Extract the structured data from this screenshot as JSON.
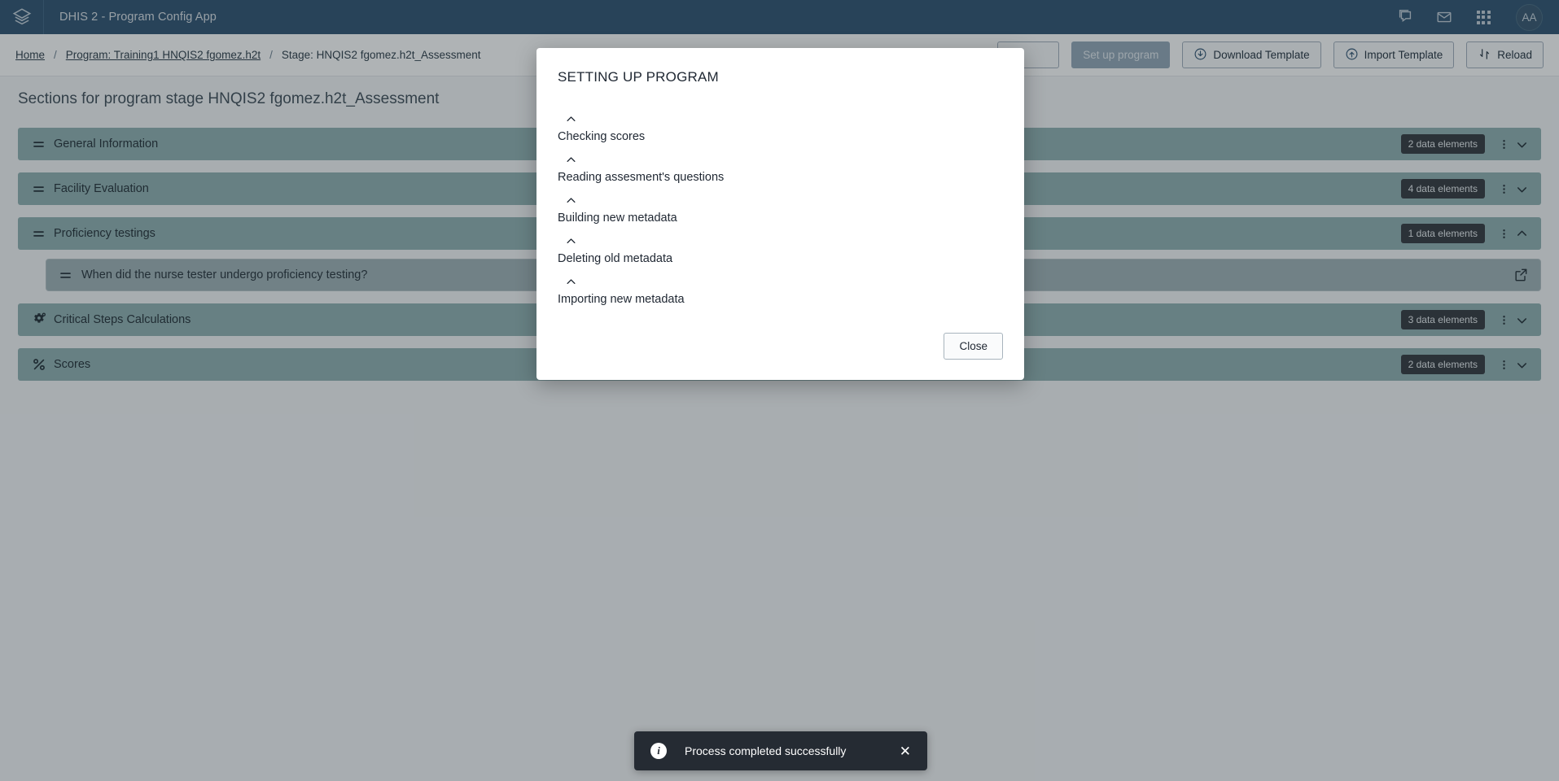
{
  "header": {
    "app_title": "DHIS 2 - Program Config App",
    "logo_icon": "dhis2-layers-logo-icon",
    "icons": [
      {
        "name": "messages-icon",
        "glyph": "chat"
      },
      {
        "name": "mail-icon",
        "glyph": "envelope"
      },
      {
        "name": "apps-grid-icon",
        "glyph": "grid"
      }
    ],
    "avatar_initials": "AA"
  },
  "breadcrumb": {
    "home": "Home",
    "program": "Program: Training1 HNQIS2 fgomez.h2t",
    "stage": "Stage: HNQIS2 fgomez.h2t_Assessment",
    "separator": "/"
  },
  "toolbar": {
    "hidden_button_label": "",
    "setup_program_label": "Set up program",
    "download_template_label": "Download Template",
    "import_template_label": "Import Template",
    "reload_label": "Reload",
    "download_icon": "download-circle-icon",
    "import_icon": "upload-circle-icon",
    "reload_icon": "reload-icon"
  },
  "page": {
    "title": "Sections for program stage HNQIS2 fgomez.h2t_Assessment"
  },
  "sections": [
    {
      "label": "General Information",
      "icon": "drag-handle-icon",
      "badge": "2 data elements",
      "menu_icon": "kebab-menu-icon",
      "chevron": "chevron-down-icon",
      "expanded": false
    },
    {
      "label": "Facility Evaluation",
      "icon": "drag-handle-icon",
      "badge": "4 data elements",
      "menu_icon": "kebab-menu-icon",
      "chevron": "chevron-down-icon",
      "expanded": false
    },
    {
      "label": "Proficiency testings",
      "icon": "drag-handle-icon",
      "badge": "1 data elements",
      "menu_icon": "kebab-menu-icon",
      "chevron": "chevron-up-icon",
      "expanded": true,
      "children": [
        {
          "label": "When did the nurse tester undergo proficiency testing?",
          "icon": "drag-handle-icon",
          "action_icon": "external-link-icon"
        }
      ]
    },
    {
      "label": "Critical Steps Calculations",
      "icon": "gears-icon",
      "badge": "3 data elements",
      "menu_icon": "kebab-menu-icon",
      "chevron": "chevron-down-icon",
      "expanded": false
    },
    {
      "label": "Scores",
      "icon": "percent-icon",
      "badge": "2 data elements",
      "menu_icon": "kebab-menu-icon",
      "chevron": "chevron-down-icon",
      "expanded": false
    }
  ],
  "modal": {
    "title": "SETTING UP PROGRAM",
    "steps": [
      {
        "icon": "chevron-up-icon",
        "label": "Checking scores"
      },
      {
        "icon": "chevron-up-icon",
        "label": "Reading assesment's questions"
      },
      {
        "icon": "chevron-up-icon",
        "label": "Building new metadata"
      },
      {
        "icon": "chevron-up-icon",
        "label": "Deleting old metadata"
      },
      {
        "icon": "chevron-up-icon",
        "label": "Importing new metadata"
      }
    ],
    "close_label": "Close"
  },
  "toast": {
    "icon": "info-icon",
    "icon_glyph": "i",
    "message": "Process completed successfully",
    "close_icon": "close-icon",
    "close_glyph": "✕"
  },
  "colors": {
    "header_bar": "#2c5070",
    "section_row": "#8fb0b1",
    "badge": "#31363c",
    "toast": "#252b33",
    "primary_disabled": "#92a7b8"
  }
}
